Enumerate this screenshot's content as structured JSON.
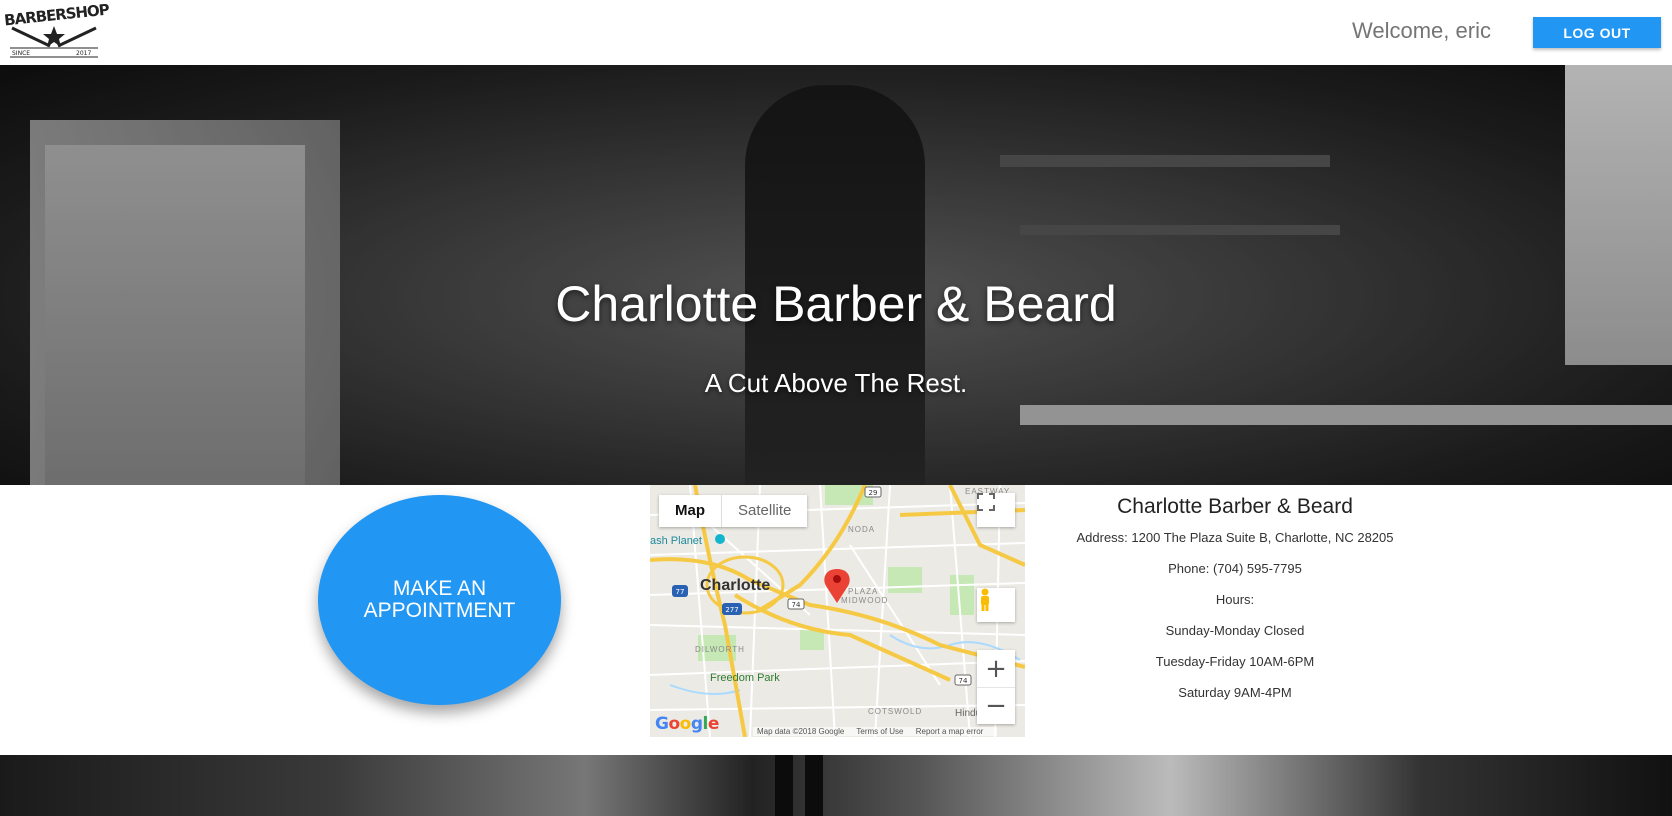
{
  "header": {
    "logo_text": "BARBERSHOP",
    "logo_since": "SINCE",
    "logo_year": "2017",
    "welcome": "Welcome, eric",
    "logout_label": "LOG OUT"
  },
  "hero": {
    "title": "Charlotte Barber & Beard",
    "subtitle": "A Cut Above The Rest."
  },
  "appointment": {
    "line1": "MAKE AN",
    "line2": "APPOINTMENT"
  },
  "map": {
    "type_map": "Map",
    "type_satellite": "Satellite",
    "city_label": "Charlotte",
    "labels": {
      "eastway": "EASTWAY",
      "noda": "NODA",
      "plaza": "PLAZA",
      "midwood": "MIDWOOD",
      "dilworth": "DILWORTH",
      "cotswold": "COTSWOLD",
      "freedom_park": "Freedom Park",
      "splash_planet": "ash Planet",
      "hindu_center": "Hindu Center"
    },
    "shields": [
      "29",
      "77",
      "277",
      "74",
      "74"
    ],
    "zoom_in": "+",
    "zoom_out": "−",
    "google": "Google",
    "attribution": {
      "data": "Map data ©2018 Google",
      "terms": "Terms of Use",
      "report": "Report a map error"
    },
    "colors": {
      "marker": "#ea4335",
      "highway": "#f6c945",
      "park": "#c5e8b5",
      "water": "#aadaff"
    }
  },
  "info": {
    "name": "Charlotte Barber & Beard",
    "address": "Address: 1200 The Plaza Suite B, Charlotte, NC 28205",
    "phone": "Phone: (704) 595-7795",
    "hours_label": "Hours:",
    "hours": [
      "Sunday-Monday Closed",
      "Tuesday-Friday 10AM-6PM",
      "Saturday 9AM-4PM"
    ]
  },
  "colors": {
    "accent": "#2196f3",
    "text_muted": "#757575"
  }
}
